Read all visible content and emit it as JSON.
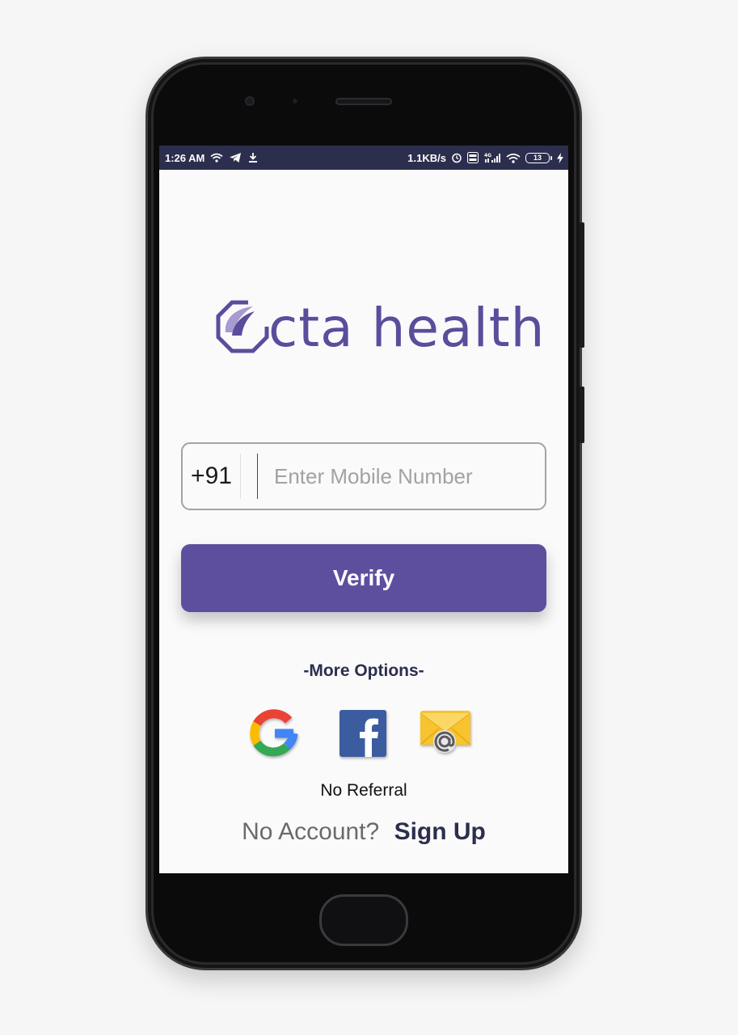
{
  "status_bar": {
    "time": "1:26 AM",
    "network_speed": "1.1KB/s",
    "battery_level": "13",
    "icons_left": [
      "wifi-icon",
      "telegram-icon",
      "download-icon"
    ],
    "icons_right": [
      "alarm-icon",
      "volte-icon",
      "4g-signal-icon",
      "wifi-icon",
      "battery-icon",
      "charging-icon"
    ]
  },
  "logo": {
    "text": "cta health",
    "color": "#5b4d9c"
  },
  "login": {
    "country_code": "+91",
    "mobile_placeholder": "Enter Mobile Number",
    "mobile_value": "",
    "verify_label": "Verify"
  },
  "more_options": {
    "label": "-More Options-",
    "providers": [
      "google-icon",
      "facebook-icon",
      "email-icon"
    ]
  },
  "referral_label": "No Referral",
  "signup": {
    "prompt": "No Account?",
    "link": "Sign Up"
  },
  "colors": {
    "accent": "#5e4f9e",
    "status_bar": "#2c2e4d",
    "background": "#fafafb"
  }
}
